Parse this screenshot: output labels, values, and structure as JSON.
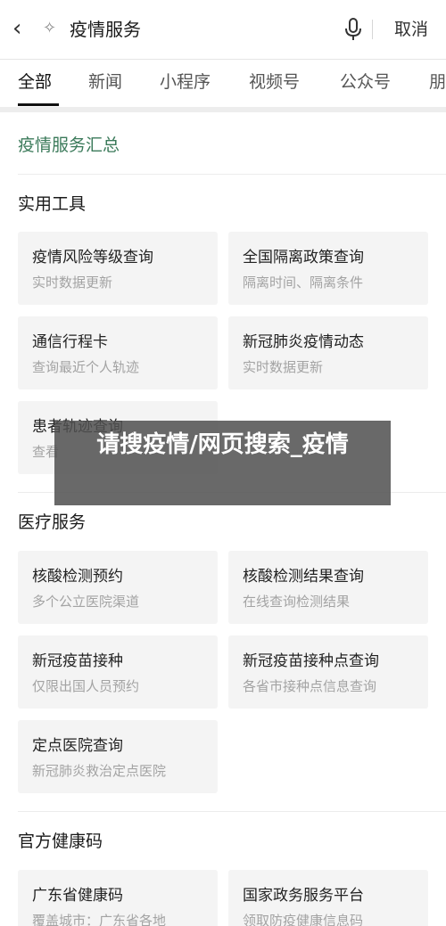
{
  "header": {
    "back_icon": "chevron-left-icon",
    "sparkle_icon": "sparkle-icon",
    "search_text": "疫情服务",
    "mic_icon": "microphone-icon",
    "cancel_label": "取消"
  },
  "tabs": [
    {
      "label": "全部"
    },
    {
      "label": "新闻"
    },
    {
      "label": "小程序"
    },
    {
      "label": "视频号"
    },
    {
      "label": "公众号"
    },
    {
      "label": "朋"
    }
  ],
  "summary_title": "疫情服务汇总",
  "sections": [
    {
      "title": "实用工具",
      "cards": [
        {
          "title": "疫情风险等级查询",
          "subtitle": "实时数据更新"
        },
        {
          "title": "全国隔离政策查询",
          "subtitle": "隔离时间、隔离条件"
        },
        {
          "title": "通信行程卡",
          "subtitle": "查询最近个人轨迹"
        },
        {
          "title": "新冠肺炎疫情动态",
          "subtitle": "实时数据更新"
        },
        {
          "title": "患者轨迹查询",
          "subtitle": "查看"
        }
      ]
    },
    {
      "title": "医疗服务",
      "cards": [
        {
          "title": "核酸检测预约",
          "subtitle": "多个公立医院渠道"
        },
        {
          "title": "核酸检测结果查询",
          "subtitle": "在线查询检测结果"
        },
        {
          "title": "新冠疫苗接种",
          "subtitle": "仅限出国人员预约"
        },
        {
          "title": "新冠疫苗接种点查询",
          "subtitle": "各省市接种点信息查询"
        },
        {
          "title": "定点医院查询",
          "subtitle": "新冠肺炎救治定点医院"
        }
      ]
    },
    {
      "title": "官方健康码",
      "cards": [
        {
          "title": "广东省健康码",
          "subtitle": "覆盖城市：广东省各地"
        },
        {
          "title": "国家政务服务平台",
          "subtitle": "领取防疫健康信息码"
        }
      ]
    }
  ],
  "overlay_text": "请搜疫情/网页搜索_疫情",
  "colors": {
    "accent_green": "#3b7a5a",
    "overlay": "#505050"
  }
}
